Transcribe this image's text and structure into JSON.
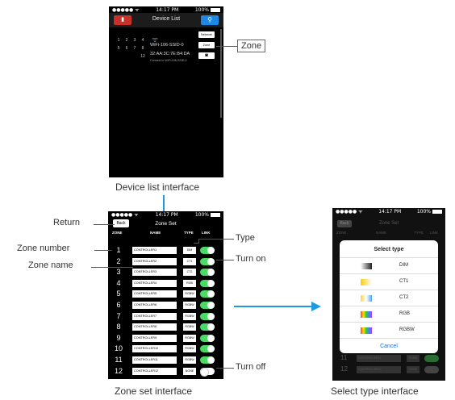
{
  "device_list": {
    "status_time": "14:17 PM",
    "status_battery": "100%",
    "title": "Device List",
    "search_icon": "search-icon",
    "grid_numbers": [
      "1",
      "2",
      "3",
      "4",
      "5",
      "6",
      "7",
      "8",
      "12"
    ],
    "ssid": "WiFi-106-SSID-0",
    "mac": "32:AA:3C:7E:B4:DA",
    "connected": "Connect to WiFi-106-SSID-0",
    "network_button": "Network",
    "zone_button": "Zone",
    "camera_icon": "camera-icon",
    "caption": "Device list interface"
  },
  "callouts": {
    "zone": "Zone",
    "return": "Return",
    "zone_number": "Zone number",
    "zone_name": "Zone name",
    "type": "Type",
    "turn_on": "Turn on",
    "turn_off": "Turn off"
  },
  "zone_set": {
    "status_time": "14:17 PM",
    "status_battery": "100%",
    "back": "Back",
    "title": "Zone Set",
    "headers": {
      "zone": "ZONE",
      "name": "NAME",
      "type": "TYPE",
      "link": "LINK"
    },
    "rows": [
      {
        "num": "1",
        "name": "CONTROLLER1",
        "type": "DIM",
        "on": true
      },
      {
        "num": "2",
        "name": "CONTROLLER2",
        "type": "CT1",
        "on": true
      },
      {
        "num": "3",
        "name": "CONTROLLER3",
        "type": "CT2",
        "on": true
      },
      {
        "num": "4",
        "name": "CONTROLLER4",
        "type": "RGB",
        "on": true
      },
      {
        "num": "5",
        "name": "CONTROLLER5",
        "type": "RGBW",
        "on": true
      },
      {
        "num": "6",
        "name": "CONTROLLER6",
        "type": "RGBW",
        "on": true
      },
      {
        "num": "7",
        "name": "CONTROLLER7",
        "type": "RGBW",
        "on": true
      },
      {
        "num": "8",
        "name": "CONTROLLER8",
        "type": "RGBW",
        "on": true
      },
      {
        "num": "9",
        "name": "CONTROLLER9",
        "type": "RGBW",
        "on": true
      },
      {
        "num": "10",
        "name": "CONTROLLER10",
        "type": "RGBW",
        "on": true
      },
      {
        "num": "11",
        "name": "CONTROLLER11",
        "type": "RGBW",
        "on": true
      },
      {
        "num": "12",
        "name": "CONTROLLER12",
        "type": "NONE",
        "on": false
      }
    ],
    "caption": "Zone set interface"
  },
  "select_type": {
    "status_time": "14:17 PM",
    "status_battery": "100%",
    "back": "Back",
    "title": "Zone Set",
    "headers": {
      "zone": "ZONE",
      "name": "NAME",
      "type": "TYPE",
      "link": "LINK"
    },
    "dialog_title": "Select type",
    "options": [
      "DIM",
      "CT1",
      "CT2",
      "RGB",
      "RGBW"
    ],
    "cancel": "Cancel",
    "bottom_rows": [
      {
        "num": "11",
        "name": "CONTROLLER11",
        "type": "RGBW"
      },
      {
        "num": "12",
        "name": "CONTROLLER12",
        "type": "NONE"
      }
    ],
    "caption": "Select type interface"
  },
  "colors": {
    "accent_blue": "#1e88e5",
    "toggle_green": "#4cd964",
    "delete_red": "#c8302a",
    "flow_arrow": "#1e9be0"
  }
}
